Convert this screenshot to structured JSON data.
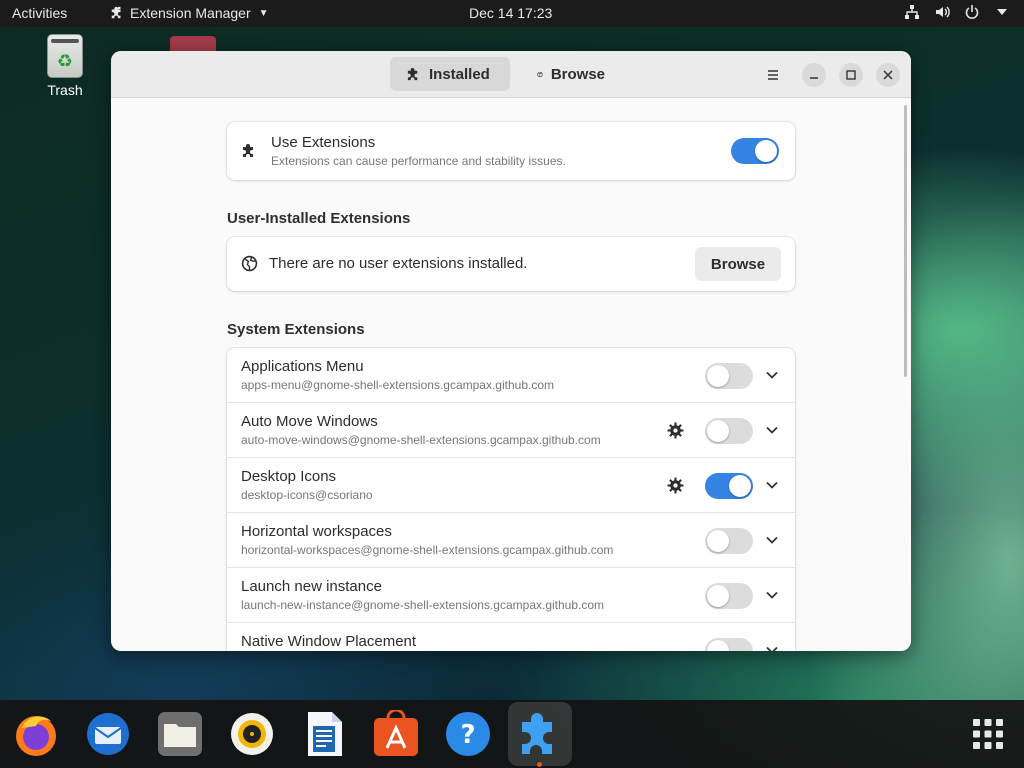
{
  "topbar": {
    "activities": "Activities",
    "app_name": "Extension Manager",
    "clock": "Dec 14  17:23"
  },
  "desktop": {
    "trash_label": "Trash"
  },
  "window": {
    "tabs": [
      {
        "label": "Installed",
        "icon": "puzzle-icon",
        "active": true
      },
      {
        "label": "Browse",
        "icon": "globe-icon",
        "active": false
      }
    ],
    "use_extensions": {
      "title": "Use Extensions",
      "subtitle": "Extensions can cause performance and stability issues.",
      "enabled": true
    },
    "user_section": {
      "heading": "User-Installed Extensions",
      "empty_text": "There are no user extensions installed.",
      "browse_label": "Browse"
    },
    "system_section": {
      "heading": "System Extensions",
      "items": [
        {
          "name": "Applications Menu",
          "uuid": "apps-menu@gnome-shell-extensions.gcampax.github.com",
          "enabled": false,
          "has_settings": false
        },
        {
          "name": "Auto Move Windows",
          "uuid": "auto-move-windows@gnome-shell-extensions.gcampax.github.com",
          "enabled": false,
          "has_settings": true
        },
        {
          "name": "Desktop Icons",
          "uuid": "desktop-icons@csoriano",
          "enabled": true,
          "has_settings": true
        },
        {
          "name": "Horizontal workspaces",
          "uuid": "horizontal-workspaces@gnome-shell-extensions.gcampax.github.com",
          "enabled": false,
          "has_settings": false
        },
        {
          "name": "Launch new instance",
          "uuid": "launch-new-instance@gnome-shell-extensions.gcampax.github.com",
          "enabled": false,
          "has_settings": false
        },
        {
          "name": "Native Window Placement",
          "uuid": "",
          "enabled": false,
          "has_settings": false
        }
      ]
    }
  },
  "colors": {
    "accent": "#3584e4",
    "dock_indicator": "#e95420"
  },
  "dock": {
    "apps": [
      "firefox-icon",
      "thunderbird-icon",
      "files-icon",
      "rhythmbox-icon",
      "writer-icon",
      "software-icon",
      "help-icon",
      "extension-manager-icon"
    ],
    "active": "extension-manager-icon"
  }
}
